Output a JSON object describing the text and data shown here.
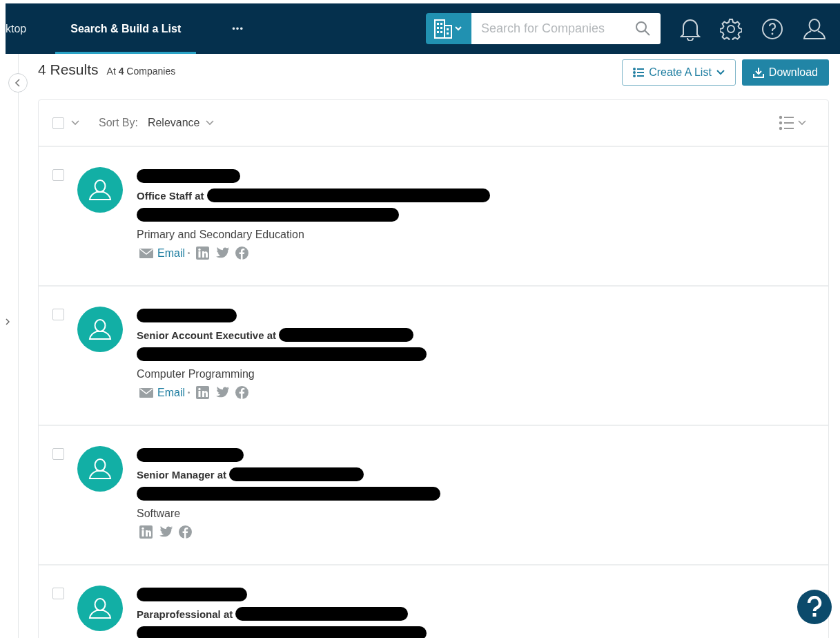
{
  "nav": {
    "tabs": [
      {
        "label": "ktop",
        "selected": false
      },
      {
        "label": "Search & Build a List",
        "selected": true
      },
      {
        "label": "•••",
        "selected": false
      }
    ],
    "search": {
      "placeholder": "Search for Companies"
    }
  },
  "header": {
    "count": "4 Results",
    "summary": "At **4** Companies",
    "buttons": [
      {
        "kind": "outline",
        "label": "Create A List"
      },
      {
        "kind": "solid",
        "label": "Download"
      }
    ]
  },
  "toolbar": {
    "select_all": {
      "checked": false
    },
    "sort_label": "Sort By:",
    "sort_value": "Relevance"
  },
  "contacts": [
    {
      "checked": false,
      "title": "Office Staff at",
      "industry": "Primary and Secondary Education",
      "email": "Email"
    },
    {
      "checked": false,
      "title": "Senior Account Executive at",
      "industry": "Computer Programming",
      "email": "Email"
    },
    {
      "checked": false,
      "title": "Senior Manager at",
      "industry": "Software"
    },
    {
      "checked": false,
      "title": "Paraprofessional at"
    }
  ]
}
